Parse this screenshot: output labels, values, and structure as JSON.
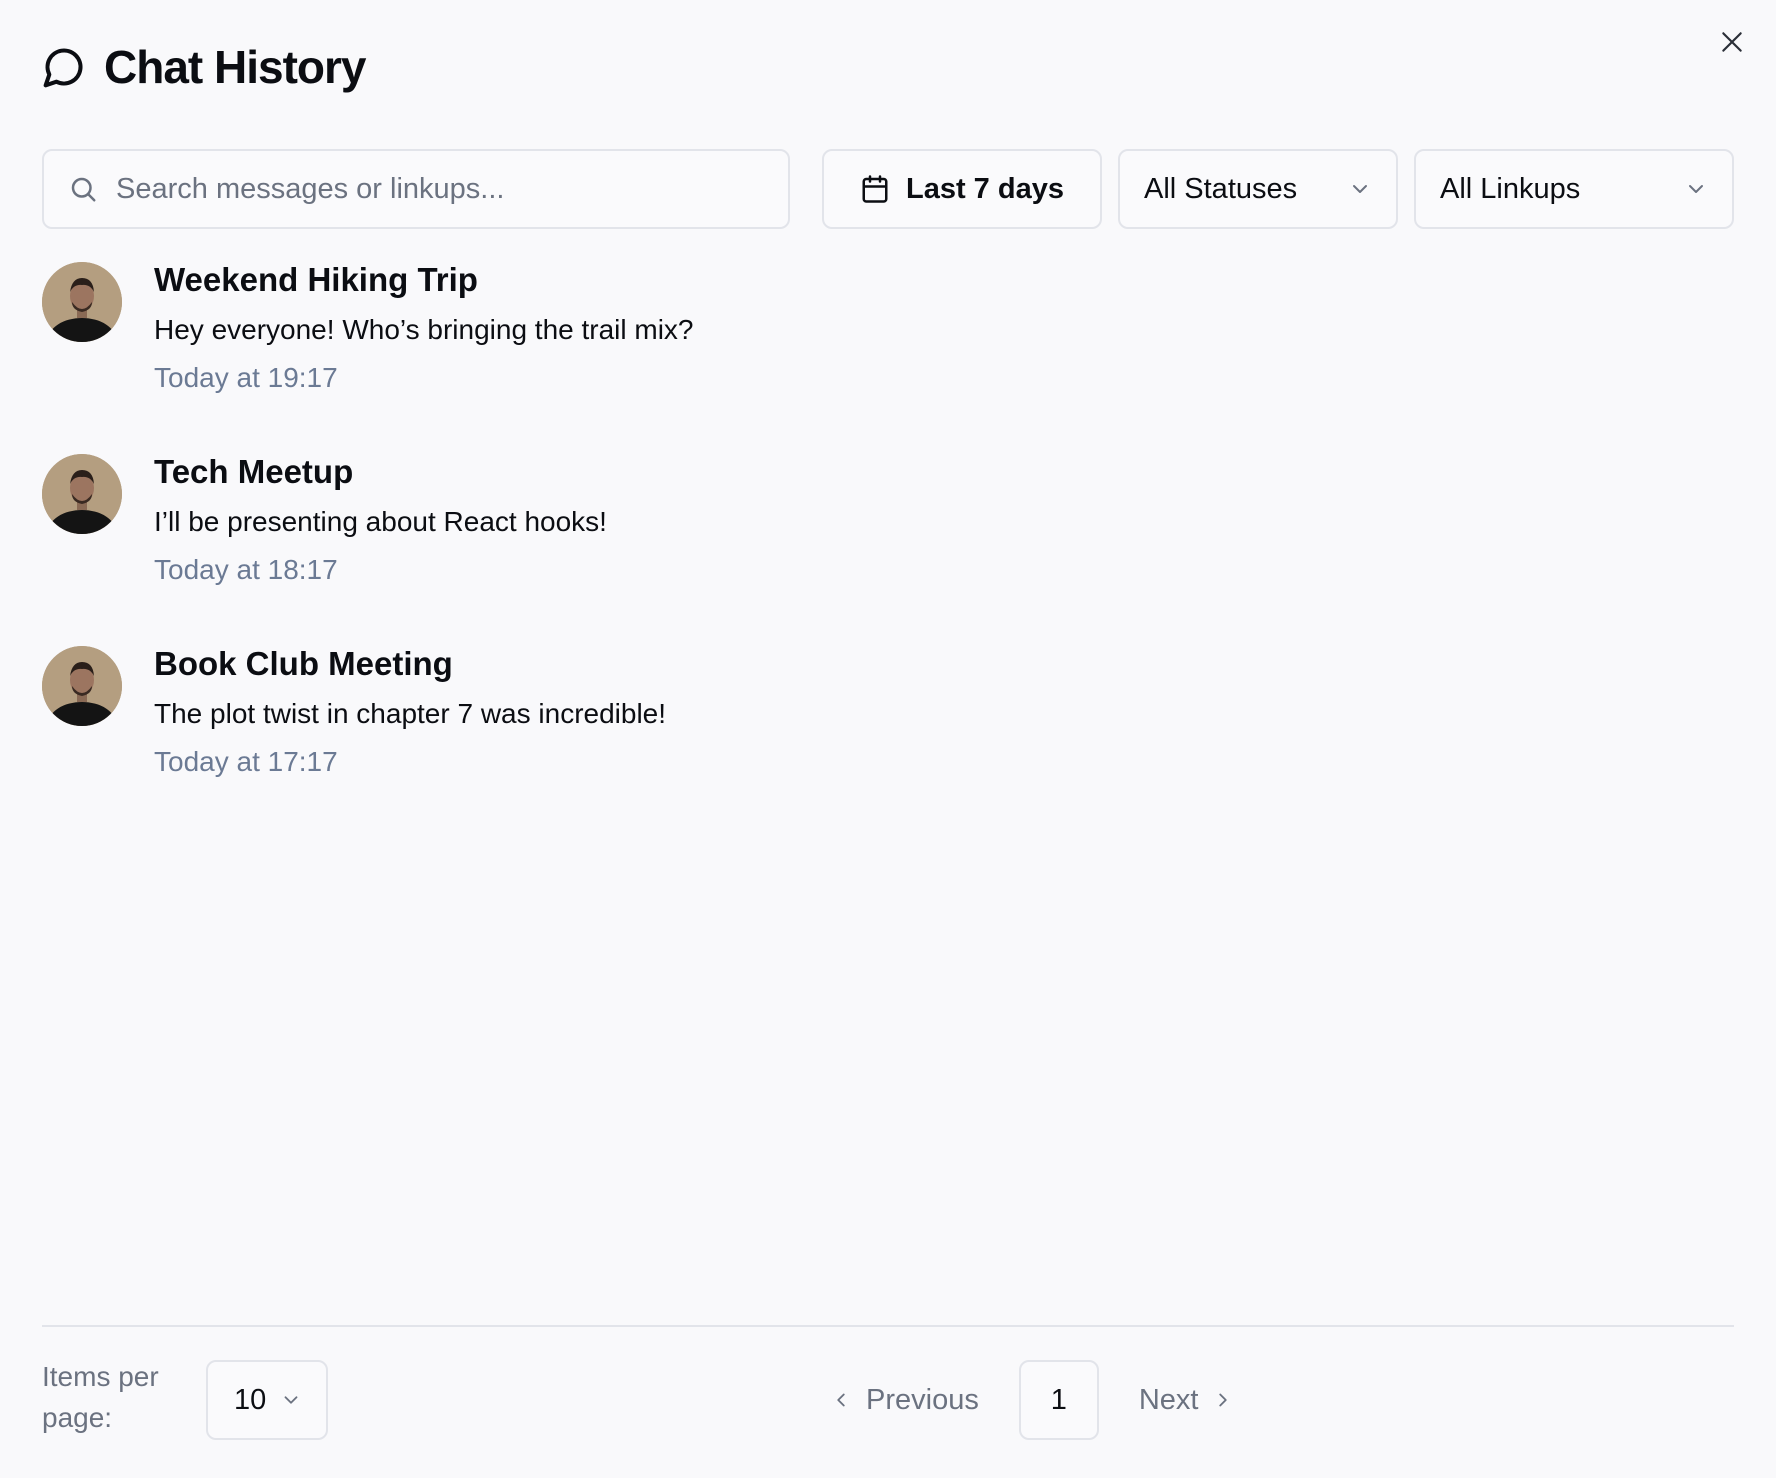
{
  "dialog": {
    "title": "Chat History",
    "title_icon": "message-circle-icon",
    "close_icon": "close-icon"
  },
  "filters": {
    "search_placeholder": "Search messages or linkups...",
    "search_value": "",
    "date_range_label": "Last 7 days",
    "status_selected": "All Statuses",
    "linkup_selected": "All Linkups"
  },
  "chats": [
    {
      "title": "Weekend Hiking Trip",
      "message": "Hey everyone! Who’s bringing the trail mix?",
      "time": "Today at 19:17"
    },
    {
      "title": "Tech Meetup",
      "message": "I’ll be presenting about React hooks!",
      "time": "Today at 18:17"
    },
    {
      "title": "Book Club Meeting",
      "message": "The plot twist in chapter 7 was incredible!",
      "time": "Today at 17:17"
    }
  ],
  "footer": {
    "items_per_page_label": "Items per page:",
    "items_per_page_value": "10",
    "previous_label": "Previous",
    "current_page": "1",
    "next_label": "Next"
  },
  "colors": {
    "background": "#f9f9fb",
    "border": "#e2e4ea",
    "text_primary": "#0b0d12",
    "text_muted": "#6b7a94"
  }
}
